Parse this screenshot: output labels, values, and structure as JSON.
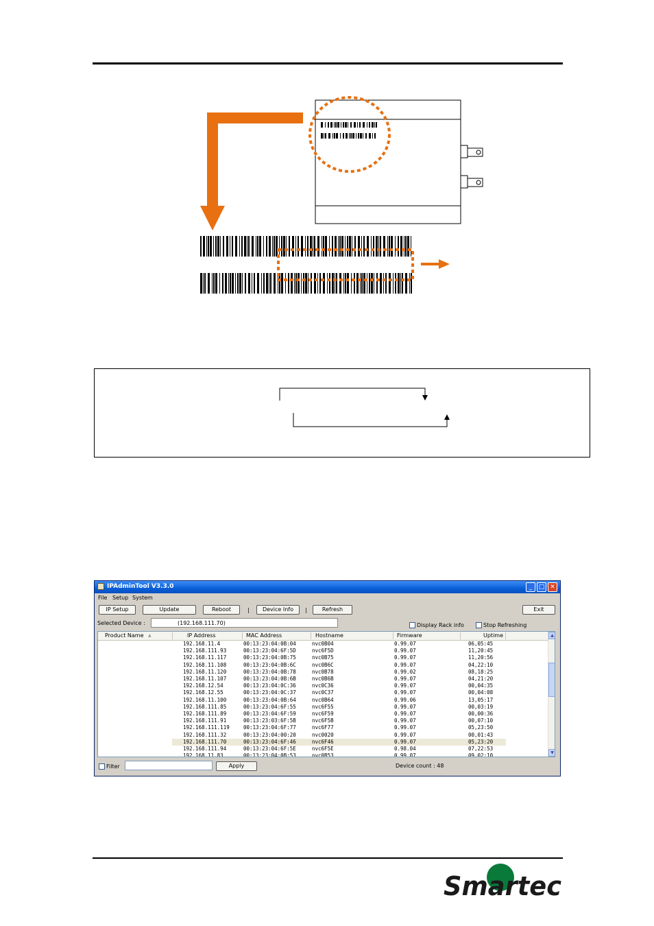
{
  "logo": {
    "text": "Smartec",
    "colors": {
      "dark": "#1a1a1a",
      "green": "#0a7a3a"
    }
  },
  "illustration": {
    "arrow_color": "#e87010"
  },
  "window": {
    "title": "IPAdminTool V3.3.0",
    "controls": {
      "minimize": "_",
      "maximize": "□",
      "close": "✕"
    },
    "menu": [
      "File",
      "Setup",
      "System"
    ],
    "toolbar": {
      "ip_setup": "IP Setup",
      "update": "Update",
      "reboot": "Reboot",
      "separator": "|",
      "device_info": "Device Info",
      "refresh": "Refresh",
      "exit": "Exit"
    },
    "selected_device_label": "Selected Device :",
    "selected_device_value": "(192.168.111.70)",
    "display_rack_info": "Display Rack info",
    "stop_refreshing": "Stop Refreshing",
    "columns": {
      "product_name": "Product Name",
      "sort_indicator": "▲",
      "ip_address": "IP Address",
      "mac_address": "MAC Address",
      "hostname": "Hostname",
      "firmware": "Firmware",
      "uptime": "Uptime"
    },
    "rows": [
      {
        "ip": "192.168.11.4",
        "mac": "00:13:23:04:0B:04",
        "host": "nvc0B04",
        "fw": "0.99.07",
        "up": "06,05:45"
      },
      {
        "ip": "192.168.111.93",
        "mac": "00:13:23:04:6F:5D",
        "host": "nvc6F5D",
        "fw": "0.99.07",
        "up": "11,20:45"
      },
      {
        "ip": "192.168.11.117",
        "mac": "00:13:23:04:0B:75",
        "host": "nvc0B75",
        "fw": "0.99.07",
        "up": "11,20:56"
      },
      {
        "ip": "192.168.11.108",
        "mac": "00:13:23:04:0B:6C",
        "host": "nvc0B6C",
        "fw": "0.99.07",
        "up": "04,22:10"
      },
      {
        "ip": "192.168.11.120",
        "mac": "00:13:23:04:0B:78",
        "host": "nvc0B78",
        "fw": "0.99.02",
        "up": "08,18:25"
      },
      {
        "ip": "192.168.11.107",
        "mac": "00:13:23:04:0B:6B",
        "host": "nvc0B6B",
        "fw": "0.99.07",
        "up": "04,21:20"
      },
      {
        "ip": "192.168.12.54",
        "mac": "00:13:23:04:0C:36",
        "host": "nvc0C36",
        "fw": "0.99.07",
        "up": "00,04:35"
      },
      {
        "ip": "192.168.12.55",
        "mac": "00:13:23:04:0C:37",
        "host": "nvc0C37",
        "fw": "0.99.07",
        "up": "00,04:08"
      },
      {
        "ip": "192.168.11.100",
        "mac": "00:13:23:04:0B:64",
        "host": "nvc0B64",
        "fw": "0.99.06",
        "up": "13,05:17"
      },
      {
        "ip": "192.168.111.85",
        "mac": "00:13:23:04:6F:55",
        "host": "nvc6F55",
        "fw": "0.99.07",
        "up": "00,03:19"
      },
      {
        "ip": "192.168.111.89",
        "mac": "00:13:23:04:6F:59",
        "host": "nvc6F59",
        "fw": "0.99.07",
        "up": "00,00:36"
      },
      {
        "ip": "192.168.111.91",
        "mac": "00:13:23:03:6F:5B",
        "host": "nvc6F5B",
        "fw": "0.99.07",
        "up": "00,07:10"
      },
      {
        "ip": "192.168.111.119",
        "mac": "00:13:23:04:6F:77",
        "host": "nvc6F77",
        "fw": "0.99.07",
        "up": "05,23:50"
      },
      {
        "ip": "192.168.111.32",
        "mac": "00:13:23:04:00:20",
        "host": "nvc0020",
        "fw": "0.99.07",
        "up": "00,01:43"
      },
      {
        "ip": "192.168.111.70",
        "mac": "00:13:23:04:6F:46",
        "host": "nvc6F46",
        "fw": "0.99.07",
        "up": "05,23:20",
        "selected": true
      },
      {
        "ip": "192.168.111.94",
        "mac": "00:13:23:04:6F:5E",
        "host": "nvc6F5E",
        "fw": "0.98.04",
        "up": "07,22:53"
      },
      {
        "ip": "192.168.11.83",
        "mac": "00:13:23:04:0B:53",
        "host": "nvc0B53",
        "fw": "0.99.07",
        "up": "09,02:10"
      }
    ],
    "filter_label": "Filter",
    "apply": "Apply",
    "device_count": "Device count : 48"
  }
}
